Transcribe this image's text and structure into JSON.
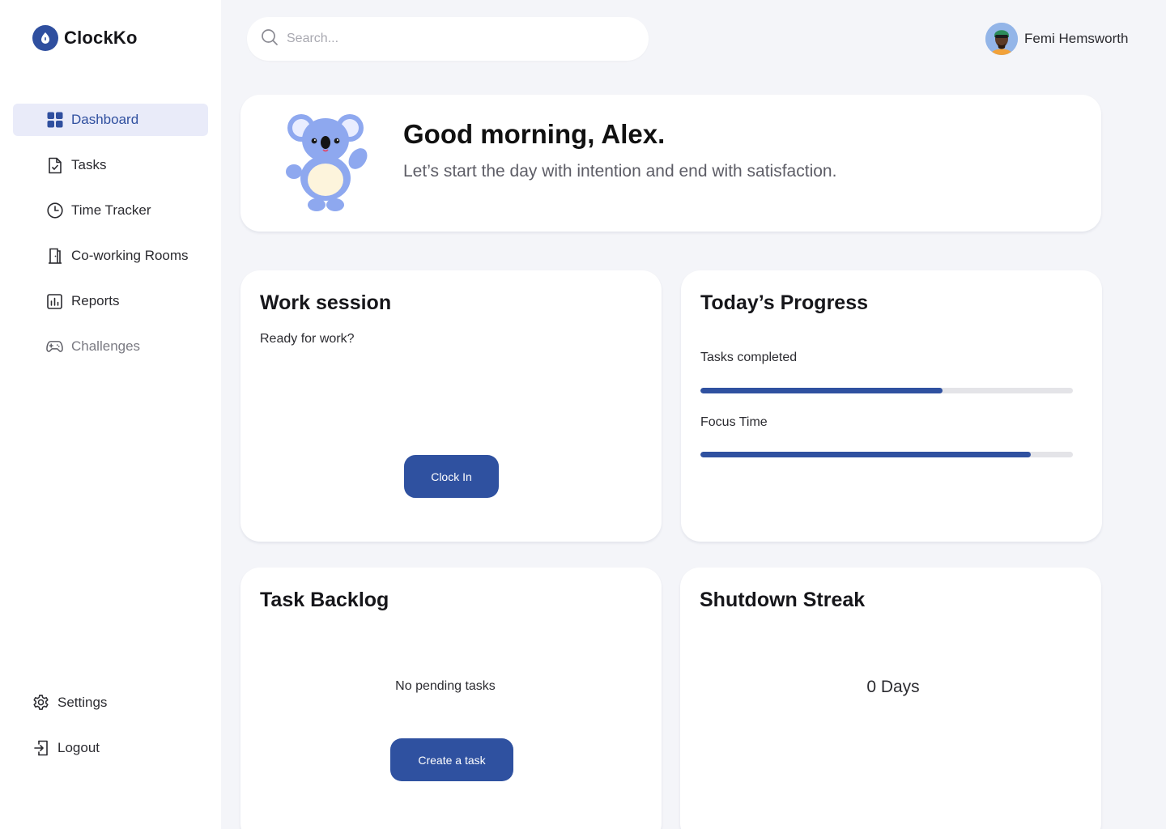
{
  "app": {
    "name": "ClockKo"
  },
  "sidebar": {
    "items": [
      {
        "label": "Dashboard",
        "icon": "dashboard-grid-icon",
        "active": true
      },
      {
        "label": "Tasks",
        "icon": "task-document-icon"
      },
      {
        "label": "Time Tracker",
        "icon": "clock-icon"
      },
      {
        "label": "Co-working Rooms",
        "icon": "door-icon"
      },
      {
        "label": "Reports",
        "icon": "bar-chart-icon"
      },
      {
        "label": "Challenges",
        "icon": "gamepad-icon"
      }
    ],
    "bottom": [
      {
        "label": "Settings",
        "icon": "gear-icon"
      },
      {
        "label": "Logout",
        "icon": "logout-icon"
      }
    ]
  },
  "search": {
    "placeholder": "Search..."
  },
  "user": {
    "name": "Femi Hemsworth"
  },
  "hero": {
    "title": "Good morning, Alex.",
    "subtitle": "Let’s start the day with intention and end with satisfaction."
  },
  "work_session": {
    "title": "Work session",
    "status": "Ready for work?",
    "button": "Clock In"
  },
  "progress": {
    "title": "Today’s Progress",
    "metrics": [
      {
        "label": "Tasks completed",
        "fraction": 0.65
      },
      {
        "label": "Focus Time",
        "fraction": 0.887
      }
    ]
  },
  "backlog": {
    "title": "Task Backlog",
    "empty": "No pending tasks",
    "button": "Create a task"
  },
  "streak": {
    "title": "Shutdown Streak",
    "value": "0 Days"
  },
  "colors": {
    "accent": "#2f51a0",
    "active_bg": "#e9ebf9",
    "background": "#f4f5f9"
  }
}
